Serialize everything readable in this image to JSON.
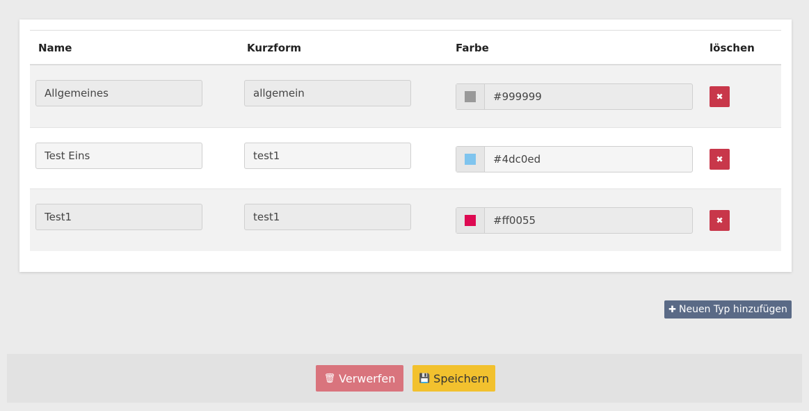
{
  "table": {
    "headers": {
      "name": "Name",
      "short": "Kurzform",
      "color": "Farbe",
      "delete": "löschen"
    },
    "rows": [
      {
        "name": "Allgemeines",
        "short": "allgemein",
        "color": "#999999"
      },
      {
        "name": "Test Eins",
        "short": "test1",
        "color": "#4dc0ed"
      },
      {
        "name": "Test1",
        "short": "test1",
        "color": "#ff0055"
      }
    ]
  },
  "actions": {
    "add_label": "Neuen Typ hinzufügen",
    "discard_label": "Verwerfen",
    "save_label": "Speichern"
  },
  "icons": {
    "delete": "times-icon",
    "add": "plus-icon",
    "discard": "trash-icon",
    "save": "floppy-icon"
  }
}
